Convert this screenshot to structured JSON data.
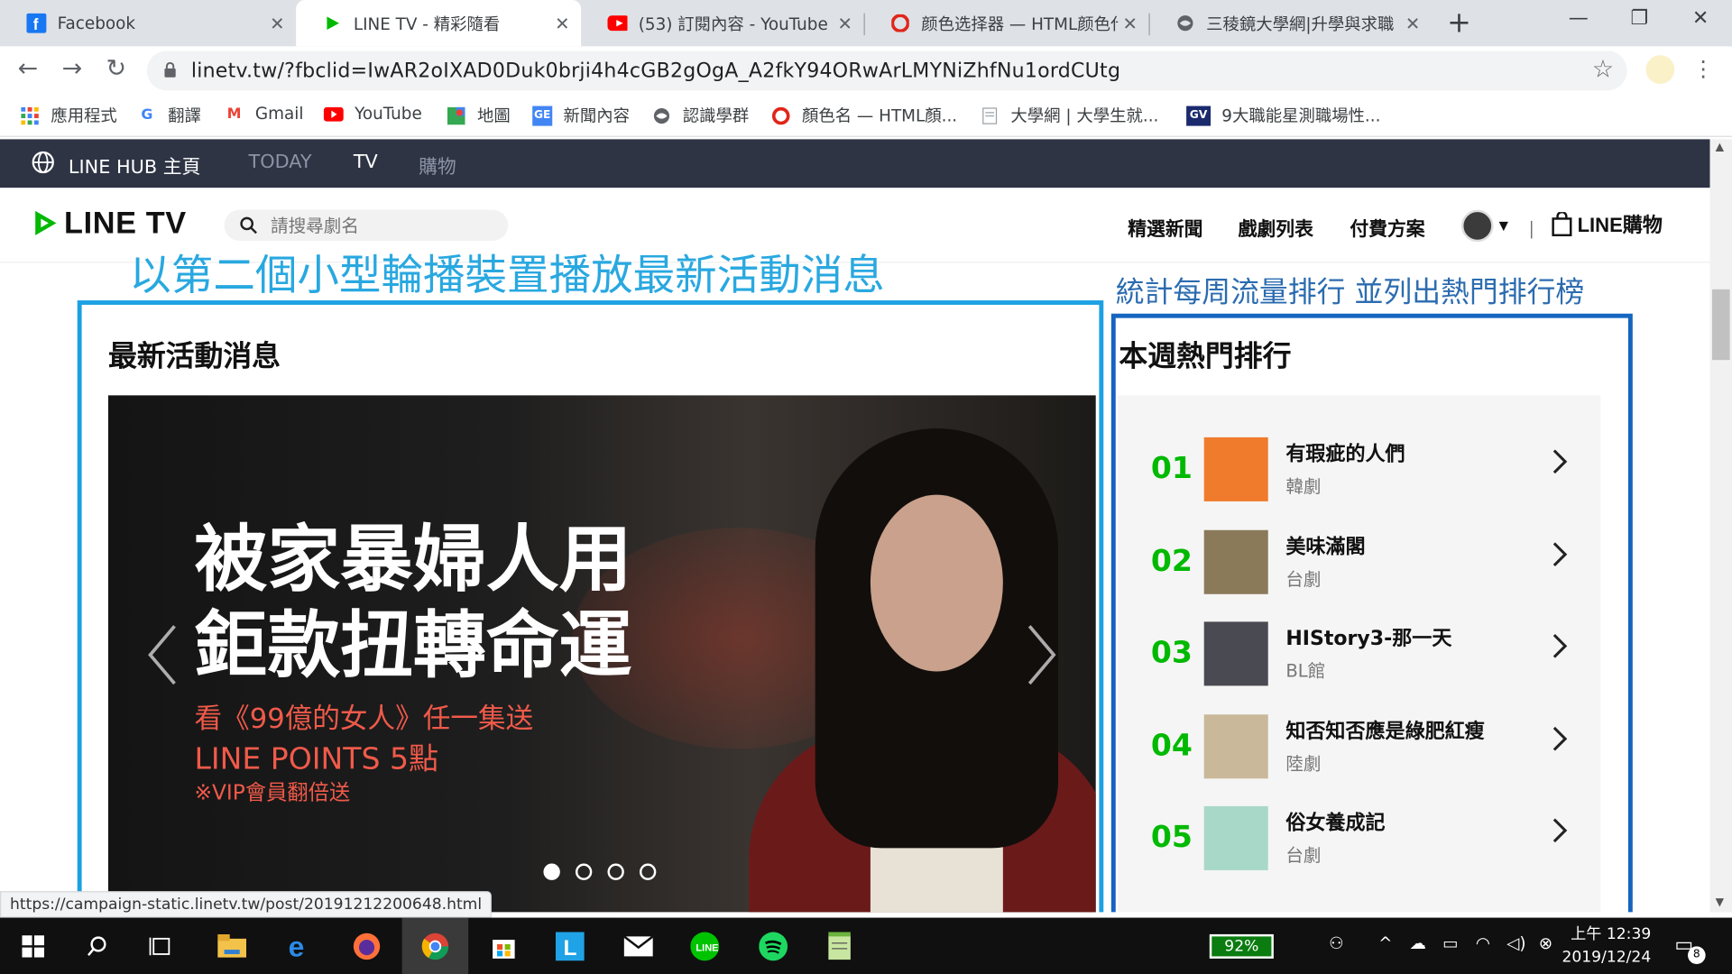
{
  "browser": {
    "tabs": [
      {
        "title": "Facebook",
        "icon": "facebook-icon"
      },
      {
        "title": "LINE TV - 精彩隨看",
        "icon": "line-tv-icon"
      },
      {
        "title": "(53) 訂閱內容 - YouTube",
        "icon": "youtube-icon"
      },
      {
        "title": "颜色选择器 — HTML颜色代",
        "icon": "opera-icon"
      },
      {
        "title": "三稜鏡大學網|升學與求職",
        "icon": "globe-icon"
      }
    ],
    "url": "linetv.tw/?fbclid=IwAR2oIXAD0Duk0brji4h4cGB2gOgA_A2fkY94ORwArLMYNiZhfNu1ordCUtg",
    "bookmarks": [
      {
        "label": "應用程式"
      },
      {
        "label": "翻譯"
      },
      {
        "label": "Gmail"
      },
      {
        "label": "YouTube"
      },
      {
        "label": "地圖"
      },
      {
        "label": "新聞內容"
      },
      {
        "label": "認識學群"
      },
      {
        "label": "顏色名 — HTML顏..."
      },
      {
        "label": "大學網 | 大學生就..."
      },
      {
        "label": "9大職能星測職場性..."
      }
    ]
  },
  "hub": {
    "home": "LINE HUB 主頁",
    "items": [
      "TODAY",
      "TV",
      "購物"
    ]
  },
  "header": {
    "logo": "LINE TV",
    "search_placeholder": "請搜尋劇名",
    "nav": [
      "精選新聞",
      "戲劇列表",
      "付費方案"
    ],
    "shop": "LINE購物"
  },
  "annotations": {
    "left": "以第二個小型輪播裝置播放最新活動消息",
    "right": "統計每周流量排行 並列出熱門排行榜"
  },
  "news": {
    "title": "最新活動消息",
    "banner": {
      "line1": "被家暴婦人用",
      "line2": "鉅款扭轉命運",
      "sub1": "看《99億的女人》任一集送",
      "sub2": "LINE POINTS 5點",
      "sub3": "※VIP會員翻倍送"
    },
    "dots_total": 4,
    "active_dot": 1
  },
  "ranking": {
    "title": "本週熱門排行",
    "items": [
      {
        "num": "01",
        "title": "有瑕疵的人們",
        "genre": "韓劇",
        "color": "#f07b2c"
      },
      {
        "num": "02",
        "title": "美味滿閣",
        "genre": "台劇",
        "color": "#8a7a5a"
      },
      {
        "num": "03",
        "title": "HIStory3-那一天",
        "genre": "BL館",
        "color": "#4a4a52"
      },
      {
        "num": "04",
        "title": "知否知否應是綠肥紅瘦",
        "genre": "陸劇",
        "color": "#c9b89a"
      },
      {
        "num": "05",
        "title": "俗女養成記",
        "genre": "台劇",
        "color": "#a8d8c8"
      }
    ]
  },
  "status_url": "https://campaign-static.linetv.tw/post/20191212200648.html",
  "taskbar": {
    "battery": "92%",
    "time": "上午 12:39",
    "date": "2019/12/24",
    "notifications": "8"
  },
  "colors": {
    "accent_green": "#00b900",
    "hub_bg": "#2e3444",
    "annot_light": "#29a8e0",
    "annot_dark": "#2b6cb0"
  }
}
